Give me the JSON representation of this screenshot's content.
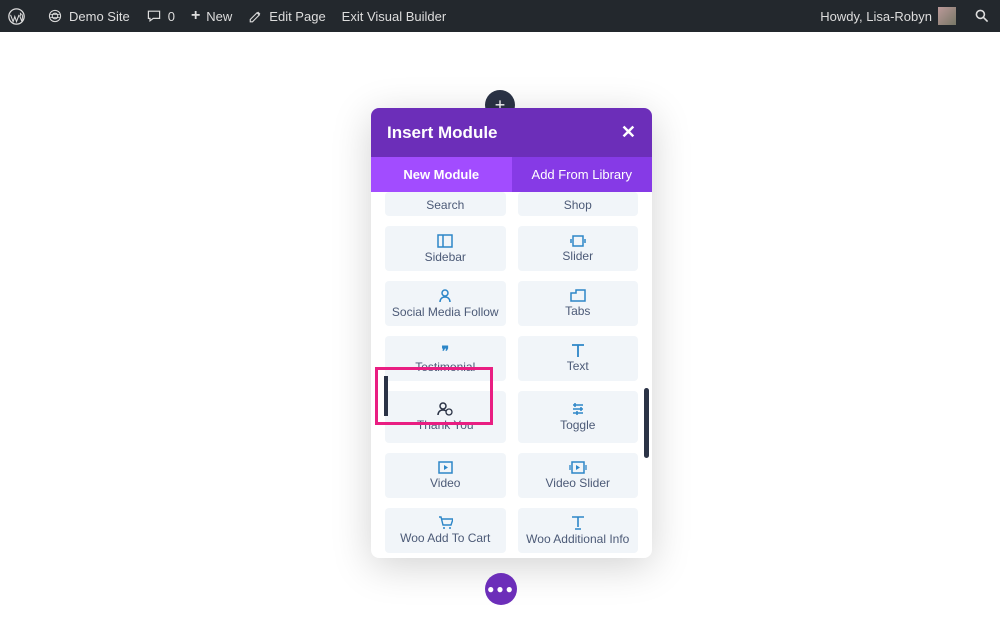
{
  "wpbar": {
    "site": "Demo Site",
    "comments": "0",
    "new": "New",
    "edit": "Edit Page",
    "exit": "Exit Visual Builder",
    "howdy": "Howdy, Lisa-Robyn"
  },
  "modal": {
    "title": "Insert Module",
    "tabs": {
      "new": "New Module",
      "library": "Add From Library"
    }
  },
  "modules": {
    "search": "Search",
    "shop": "Shop",
    "sidebar": "Sidebar",
    "slider": "Slider",
    "social": "Social Media Follow",
    "tabs": "Tabs",
    "testimonial": "Testimonial",
    "text": "Text",
    "thankyou": "Thank You",
    "toggle": "Toggle",
    "video": "Video",
    "videoslider": "Video Slider",
    "wooadd": "Woo Add To Cart",
    "wooinfo": "Woo Additional Info"
  }
}
